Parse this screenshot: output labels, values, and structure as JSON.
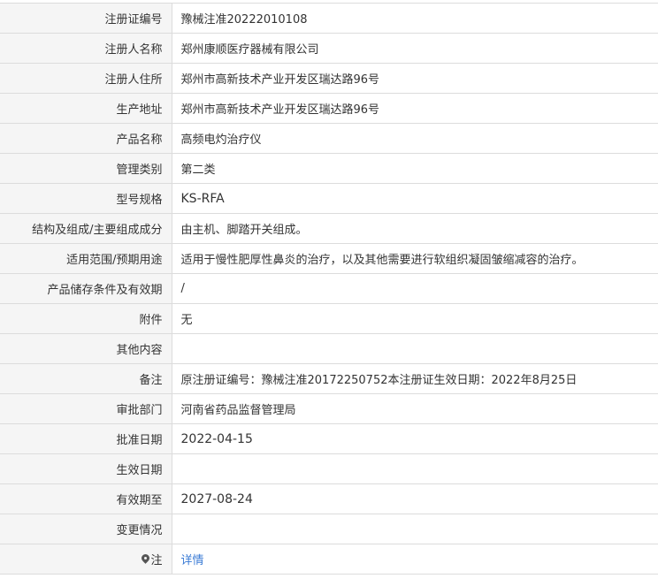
{
  "record": {
    "rows": [
      {
        "label": "注册证编号",
        "value": "豫械注准20222010108"
      },
      {
        "label": "注册人名称",
        "value": "郑州康顺医疗器械有限公司"
      },
      {
        "label": "注册人住所",
        "value": "郑州市高新技术产业开发区瑞达路96号"
      },
      {
        "label": "生产地址",
        "value": "郑州市高新技术产业开发区瑞达路96号"
      },
      {
        "label": "产品名称",
        "value": "高频电灼治疗仪"
      },
      {
        "label": "管理类别",
        "value": "第二类"
      },
      {
        "label": "型号规格",
        "value": "KS-RFA"
      },
      {
        "label": "结构及组成/主要组成成分",
        "value": "由主机、脚踏开关组成。"
      },
      {
        "label": "适用范围/预期用途",
        "value": "适用于慢性肥厚性鼻炎的治疗，以及其他需要进行软组织凝固皱缩减容的治疗。"
      },
      {
        "label": "产品储存条件及有效期",
        "value": "/"
      },
      {
        "label": "附件",
        "value": "无"
      },
      {
        "label": "其他内容",
        "value": ""
      },
      {
        "label": "备注",
        "value": "原注册证编号：豫械注准20172250752本注册证生效日期：2022年8月25日"
      },
      {
        "label": "审批部门",
        "value": "河南省药品监督管理局"
      },
      {
        "label": "批准日期",
        "value": "2022-04-15"
      },
      {
        "label": "生效日期",
        "value": ""
      },
      {
        "label": "有效期至",
        "value": "2027-08-24"
      },
      {
        "label": "变更情况",
        "value": ""
      }
    ],
    "note": {
      "label": "注",
      "icon": "pin-icon",
      "link_text": "详情"
    }
  },
  "colors": {
    "label_background": "#f5f5f5",
    "border": "#dcdcdc",
    "text": "#333333",
    "link": "#3a7bd5"
  }
}
